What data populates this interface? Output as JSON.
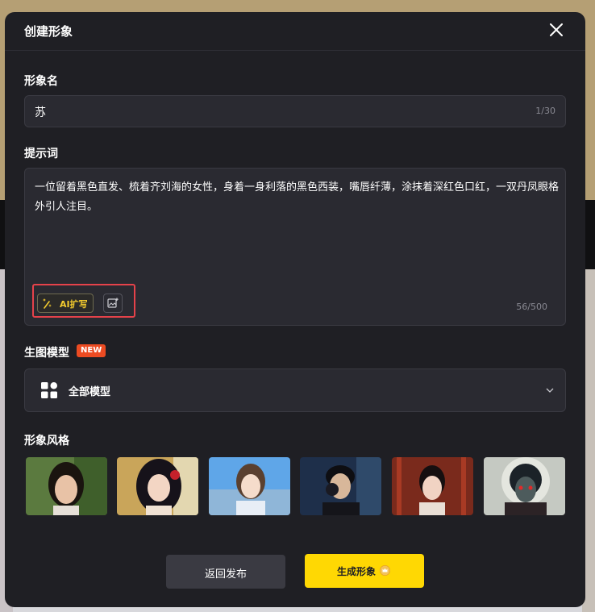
{
  "modal": {
    "title": "创建形象"
  },
  "name_section": {
    "label": "形象名",
    "value": "苏",
    "counter": "1/30"
  },
  "prompt_section": {
    "label": "提示词",
    "text": "一位留着黑色直发、梳着齐刘海的女性，身着一身利落的黑色西装，嘴唇纤薄，涂抹着深红色口红，一双丹凤眼格外引人注目。",
    "counter": "56/500",
    "ai_expand_label": "AI扩写",
    "image_tool_icon": "add-image-icon"
  },
  "model_section": {
    "label": "生图模型",
    "badge": "NEW",
    "selected": "全部模型"
  },
  "style_section": {
    "label": "形象风格",
    "thumbnails": [
      {
        "icon": "portrait-thumbnail"
      },
      {
        "icon": "portrait-thumbnail"
      },
      {
        "icon": "portrait-thumbnail"
      },
      {
        "icon": "portrait-thumbnail"
      },
      {
        "icon": "portrait-thumbnail"
      },
      {
        "icon": "portrait-thumbnail"
      }
    ]
  },
  "footer": {
    "back_label": "返回发布",
    "generate_label": "生成形象"
  },
  "colors": {
    "accent": "#ffd803",
    "badge": "#ec4b22",
    "highlight": "#e5424a",
    "modal_bg": "#1f1f24",
    "field_bg": "#2a2a31"
  }
}
